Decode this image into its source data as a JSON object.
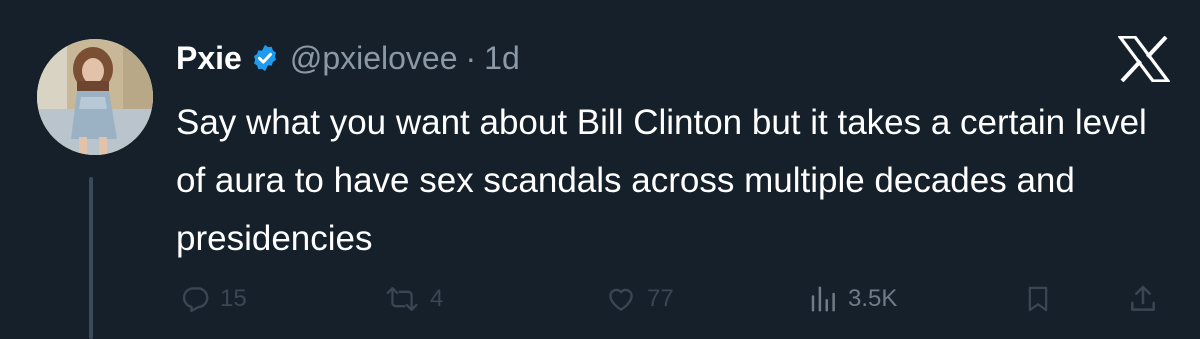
{
  "tweet": {
    "author": {
      "display_name": "Pxie",
      "handle": "@pxielovee",
      "separator": "·",
      "time": "1d",
      "verified": true
    },
    "text": "Say what you want about Bill Clinton but it takes a certain level of aura to have sex scandals across multiple decades and presidencies",
    "actions": {
      "replies": "15",
      "retweets": "4",
      "likes": "77",
      "views": "3.5K"
    }
  },
  "icons": {
    "brand": "x-logo-icon",
    "verified": "verified-badge-icon",
    "reply": "reply-icon",
    "retweet": "retweet-icon",
    "like": "heart-icon",
    "views": "views-icon",
    "bookmark": "bookmark-icon",
    "share": "share-icon"
  },
  "colors": {
    "background": "#15202b",
    "text_primary": "#ffffff",
    "text_secondary": "#8b98a5",
    "verified_blue": "#1d9bf0",
    "action_gray": "#3a4653"
  }
}
